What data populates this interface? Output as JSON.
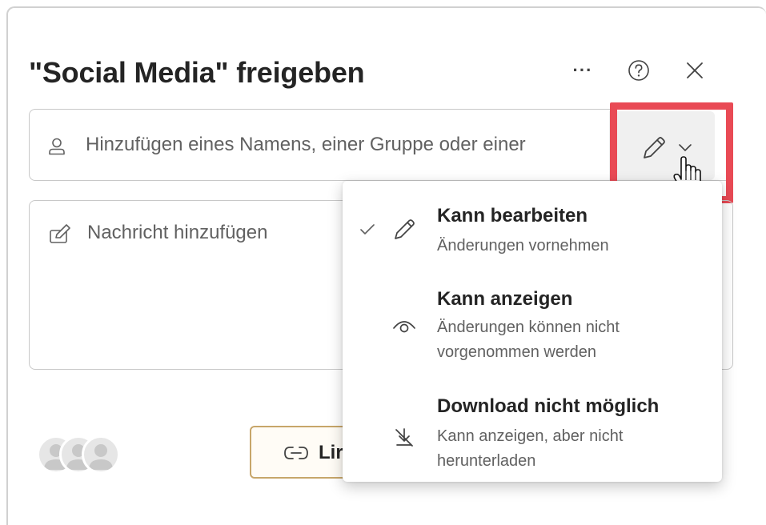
{
  "dialog": {
    "title": "\"Social Media\" freigeben",
    "more_label": "···",
    "help_icon": "help-circle-icon",
    "close_icon": "close-icon"
  },
  "name_input": {
    "placeholder": "Hinzufügen eines Namens, einer Gruppe oder einer",
    "icon": "person-icon"
  },
  "permission_button": {
    "icon": "pencil-icon",
    "chevron": "chevron-down-icon",
    "highlight_color": "#e94a55"
  },
  "message_input": {
    "placeholder": "Nachricht hinzufügen",
    "icon": "compose-icon"
  },
  "link_button": {
    "label": "Lir",
    "icon": "link-icon",
    "border_color": "#c7a66a"
  },
  "permission_menu": {
    "items": [
      {
        "title": "Kann bearbeiten",
        "description": "Änderungen vornehmen",
        "icon": "pencil-icon",
        "selected": true
      },
      {
        "title": "Kann anzeigen",
        "description": "Änderungen können nicht vorgenommen werden",
        "icon": "eye-icon",
        "selected": false
      },
      {
        "title": "Download nicht möglich",
        "description": "Kann anzeigen, aber nicht herunterladen",
        "icon": "no-download-icon",
        "selected": false
      }
    ]
  }
}
